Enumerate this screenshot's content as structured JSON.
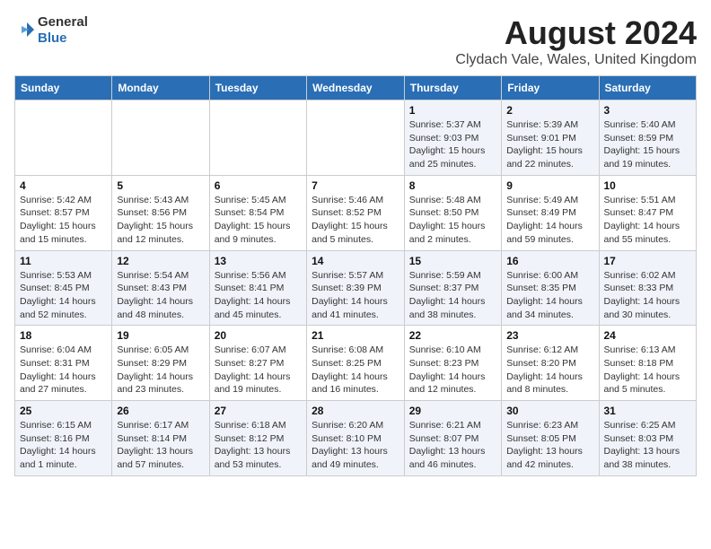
{
  "header": {
    "logo_general": "General",
    "logo_blue": "Blue",
    "main_title": "August 2024",
    "sub_title": "Clydach Vale, Wales, United Kingdom"
  },
  "weekdays": [
    "Sunday",
    "Monday",
    "Tuesday",
    "Wednesday",
    "Thursday",
    "Friday",
    "Saturday"
  ],
  "weeks": [
    [
      {
        "day": "",
        "info": ""
      },
      {
        "day": "",
        "info": ""
      },
      {
        "day": "",
        "info": ""
      },
      {
        "day": "",
        "info": ""
      },
      {
        "day": "1",
        "info": "Sunrise: 5:37 AM\nSunset: 9:03 PM\nDaylight: 15 hours\nand 25 minutes."
      },
      {
        "day": "2",
        "info": "Sunrise: 5:39 AM\nSunset: 9:01 PM\nDaylight: 15 hours\nand 22 minutes."
      },
      {
        "day": "3",
        "info": "Sunrise: 5:40 AM\nSunset: 8:59 PM\nDaylight: 15 hours\nand 19 minutes."
      }
    ],
    [
      {
        "day": "4",
        "info": "Sunrise: 5:42 AM\nSunset: 8:57 PM\nDaylight: 15 hours\nand 15 minutes."
      },
      {
        "day": "5",
        "info": "Sunrise: 5:43 AM\nSunset: 8:56 PM\nDaylight: 15 hours\nand 12 minutes."
      },
      {
        "day": "6",
        "info": "Sunrise: 5:45 AM\nSunset: 8:54 PM\nDaylight: 15 hours\nand 9 minutes."
      },
      {
        "day": "7",
        "info": "Sunrise: 5:46 AM\nSunset: 8:52 PM\nDaylight: 15 hours\nand 5 minutes."
      },
      {
        "day": "8",
        "info": "Sunrise: 5:48 AM\nSunset: 8:50 PM\nDaylight: 15 hours\nand 2 minutes."
      },
      {
        "day": "9",
        "info": "Sunrise: 5:49 AM\nSunset: 8:49 PM\nDaylight: 14 hours\nand 59 minutes."
      },
      {
        "day": "10",
        "info": "Sunrise: 5:51 AM\nSunset: 8:47 PM\nDaylight: 14 hours\nand 55 minutes."
      }
    ],
    [
      {
        "day": "11",
        "info": "Sunrise: 5:53 AM\nSunset: 8:45 PM\nDaylight: 14 hours\nand 52 minutes."
      },
      {
        "day": "12",
        "info": "Sunrise: 5:54 AM\nSunset: 8:43 PM\nDaylight: 14 hours\nand 48 minutes."
      },
      {
        "day": "13",
        "info": "Sunrise: 5:56 AM\nSunset: 8:41 PM\nDaylight: 14 hours\nand 45 minutes."
      },
      {
        "day": "14",
        "info": "Sunrise: 5:57 AM\nSunset: 8:39 PM\nDaylight: 14 hours\nand 41 minutes."
      },
      {
        "day": "15",
        "info": "Sunrise: 5:59 AM\nSunset: 8:37 PM\nDaylight: 14 hours\nand 38 minutes."
      },
      {
        "day": "16",
        "info": "Sunrise: 6:00 AM\nSunset: 8:35 PM\nDaylight: 14 hours\nand 34 minutes."
      },
      {
        "day": "17",
        "info": "Sunrise: 6:02 AM\nSunset: 8:33 PM\nDaylight: 14 hours\nand 30 minutes."
      }
    ],
    [
      {
        "day": "18",
        "info": "Sunrise: 6:04 AM\nSunset: 8:31 PM\nDaylight: 14 hours\nand 27 minutes."
      },
      {
        "day": "19",
        "info": "Sunrise: 6:05 AM\nSunset: 8:29 PM\nDaylight: 14 hours\nand 23 minutes."
      },
      {
        "day": "20",
        "info": "Sunrise: 6:07 AM\nSunset: 8:27 PM\nDaylight: 14 hours\nand 19 minutes."
      },
      {
        "day": "21",
        "info": "Sunrise: 6:08 AM\nSunset: 8:25 PM\nDaylight: 14 hours\nand 16 minutes."
      },
      {
        "day": "22",
        "info": "Sunrise: 6:10 AM\nSunset: 8:23 PM\nDaylight: 14 hours\nand 12 minutes."
      },
      {
        "day": "23",
        "info": "Sunrise: 6:12 AM\nSunset: 8:20 PM\nDaylight: 14 hours\nand 8 minutes."
      },
      {
        "day": "24",
        "info": "Sunrise: 6:13 AM\nSunset: 8:18 PM\nDaylight: 14 hours\nand 5 minutes."
      }
    ],
    [
      {
        "day": "25",
        "info": "Sunrise: 6:15 AM\nSunset: 8:16 PM\nDaylight: 14 hours\nand 1 minute."
      },
      {
        "day": "26",
        "info": "Sunrise: 6:17 AM\nSunset: 8:14 PM\nDaylight: 13 hours\nand 57 minutes."
      },
      {
        "day": "27",
        "info": "Sunrise: 6:18 AM\nSunset: 8:12 PM\nDaylight: 13 hours\nand 53 minutes."
      },
      {
        "day": "28",
        "info": "Sunrise: 6:20 AM\nSunset: 8:10 PM\nDaylight: 13 hours\nand 49 minutes."
      },
      {
        "day": "29",
        "info": "Sunrise: 6:21 AM\nSunset: 8:07 PM\nDaylight: 13 hours\nand 46 minutes."
      },
      {
        "day": "30",
        "info": "Sunrise: 6:23 AM\nSunset: 8:05 PM\nDaylight: 13 hours\nand 42 minutes."
      },
      {
        "day": "31",
        "info": "Sunrise: 6:25 AM\nSunset: 8:03 PM\nDaylight: 13 hours\nand 38 minutes."
      }
    ]
  ]
}
